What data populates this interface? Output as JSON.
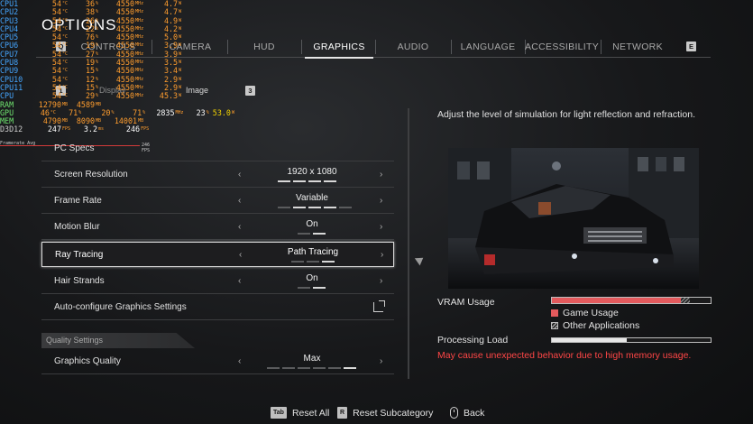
{
  "title": "OPTIONS",
  "osd": {
    "cpu_rows": [
      {
        "label": "CPU1",
        "temp": "54",
        "load": "36",
        "clock": "4550",
        "power": "4.7"
      },
      {
        "label": "CPU2",
        "temp": "54",
        "load": "38",
        "clock": "4550",
        "power": "4.7"
      },
      {
        "label": "CPU3",
        "temp": "54",
        "load": "26",
        "clock": "4550",
        "power": "4.9"
      },
      {
        "label": "CPU4",
        "temp": "54",
        "load": "22",
        "clock": "4550",
        "power": "4.2"
      },
      {
        "label": "CPU5",
        "temp": "54",
        "load": "76",
        "clock": "4550",
        "power": "5.0"
      },
      {
        "label": "CPU6",
        "temp": "54",
        "load": "19",
        "clock": "4550",
        "power": "3.9"
      },
      {
        "label": "CPU7",
        "temp": "54",
        "load": "27",
        "clock": "4550",
        "power": "3.9"
      },
      {
        "label": "CPU8",
        "temp": "54",
        "load": "19",
        "clock": "4550",
        "power": "3.5"
      },
      {
        "label": "CPU9",
        "temp": "54",
        "load": "15",
        "clock": "4550",
        "power": "3.4"
      },
      {
        "label": "CPU10",
        "temp": "54",
        "load": "12",
        "clock": "4550",
        "power": "2.9"
      },
      {
        "label": "CPU11",
        "temp": "54",
        "load": "15",
        "clock": "4550",
        "power": "2.9"
      },
      {
        "label": "CPU",
        "temp": "54",
        "load": "29",
        "clock": "4550",
        "power": "45.3"
      }
    ],
    "ram": {
      "label": "RAM",
      "v1": "12790",
      "v2": "4589"
    },
    "gpu": {
      "label": "GPU",
      "v1": "46",
      "v2": "71",
      "v3": "20",
      "v4": "71",
      "v5": "2835",
      "v6": "23",
      "v7": "53.0"
    },
    "mem": {
      "label": "MEM",
      "v1": "4790",
      "v2": "8090",
      "v3": "14001"
    },
    "d3d": {
      "label": "D3D12",
      "v1": "247",
      "v2": "3.2",
      "v3": "246"
    },
    "graph_label": "Framerate Avg",
    "graph_fps": "246 FPS"
  },
  "tabs": [
    {
      "label": "CONTROLS",
      "key": "Q"
    },
    {
      "label": "CAMERA"
    },
    {
      "label": "HUD"
    },
    {
      "label": "GRAPHICS",
      "active": true
    },
    {
      "label": "AUDIO"
    },
    {
      "label": "LANGUAGE"
    },
    {
      "label": "ACCESSIBILITY"
    },
    {
      "label": "NETWORK",
      "key": "E"
    }
  ],
  "subtabs": {
    "key_left": "1",
    "display": "Display",
    "image": "Image",
    "key_right": "3"
  },
  "rows": [
    {
      "label": "PC Specs"
    },
    {
      "label": "Screen Resolution",
      "value": "1920 x 1080",
      "ticks": [
        1,
        1,
        1,
        1
      ]
    },
    {
      "label": "Frame Rate",
      "value": "Variable",
      "ticks": [
        0,
        1,
        1,
        1,
        0
      ]
    },
    {
      "label": "Motion Blur",
      "value": "On",
      "ticks": [
        0,
        1
      ]
    },
    {
      "label": "Ray Tracing",
      "value": "Path Tracing",
      "ticks": [
        0,
        0,
        1
      ],
      "selected": true
    },
    {
      "label": "Hair Strands",
      "value": "On",
      "ticks": [
        0,
        1
      ]
    },
    {
      "label": "Auto-configure Graphics Settings"
    }
  ],
  "quality_section": "Quality Settings",
  "graphics_quality": {
    "label": "Graphics Quality",
    "value": "Max",
    "ticks": [
      0,
      0,
      0,
      0,
      0,
      1
    ]
  },
  "description": "Adjust the level of simulation for light reflection and refraction.",
  "vram": {
    "label": "VRAM Usage",
    "game_fraction": 0.81,
    "other_fraction": 0.06,
    "legend_game": "Game Usage",
    "legend_other": "Other Applications",
    "game_color": "#e35a5d"
  },
  "processing": {
    "label": "Processing Load",
    "fraction": 0.47
  },
  "warning": "May cause unexpected behavior due to high memory usage.",
  "footer": {
    "reset_all_key": "Tab",
    "reset_all": "Reset All",
    "reset_sub_key": "R",
    "reset_sub": "Reset Subcategory",
    "back": "Back"
  }
}
